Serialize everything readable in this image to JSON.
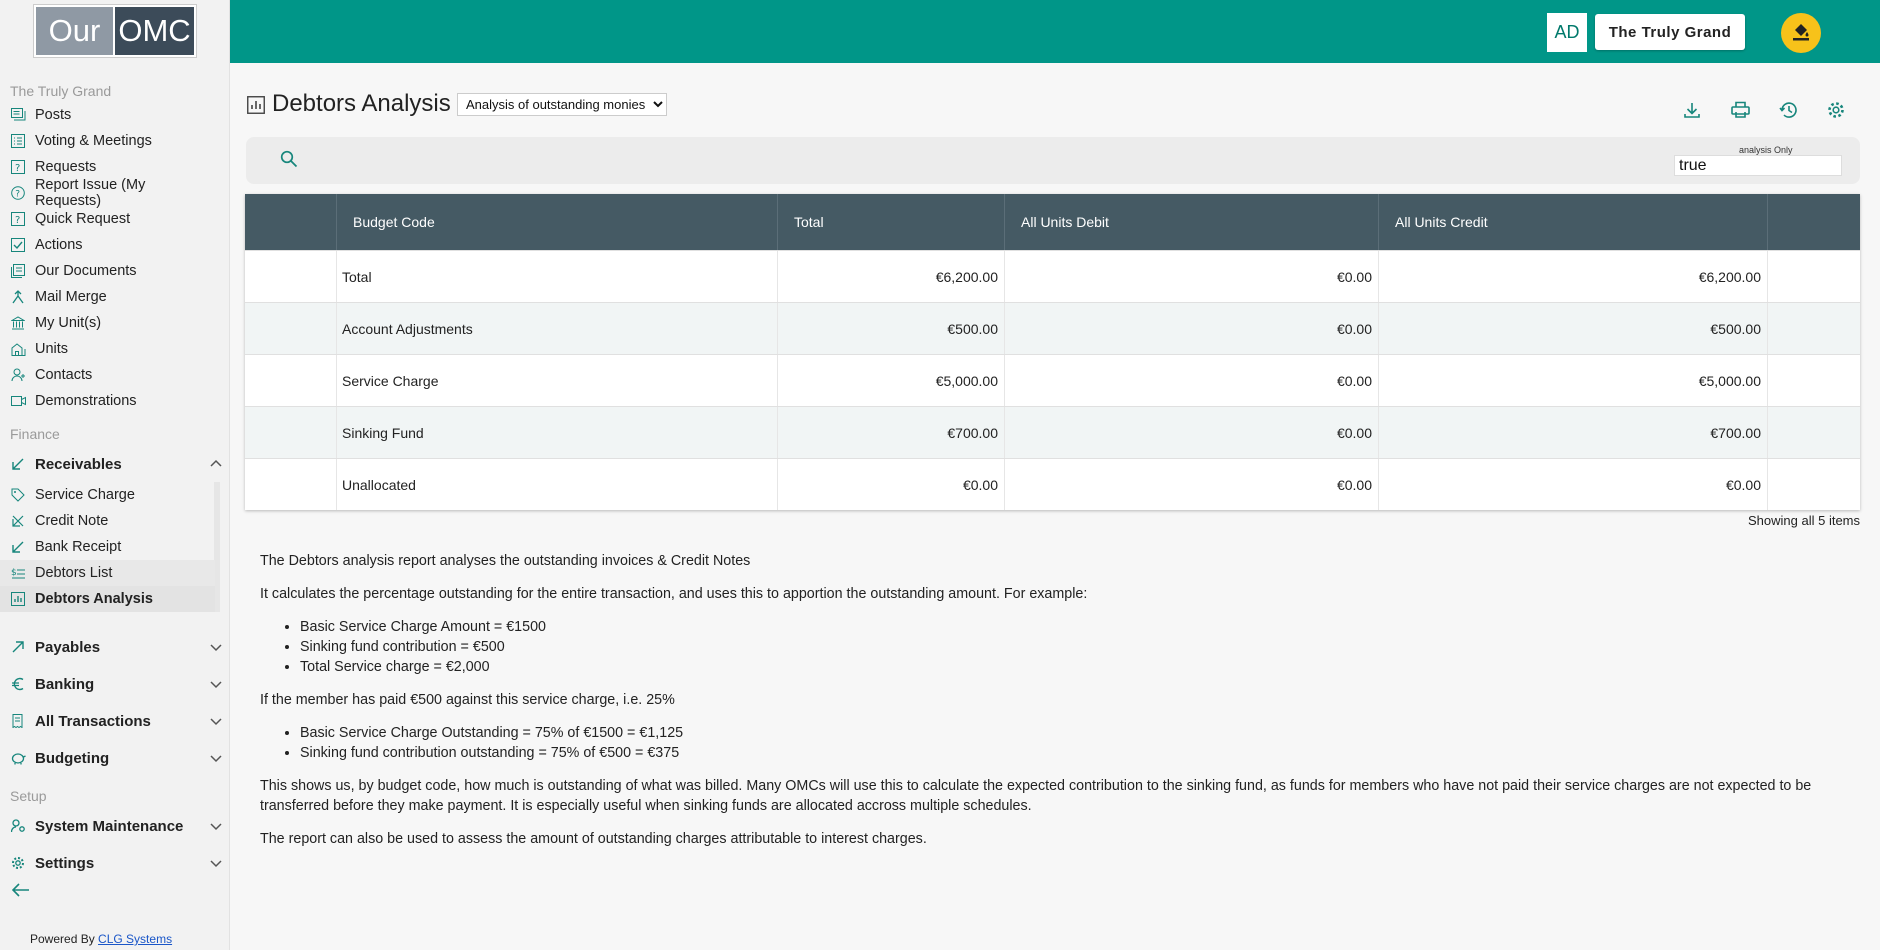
{
  "logo": {
    "part1": "Our",
    "part2": "OMC"
  },
  "sidebar": {
    "section_building": "The Truly Grand",
    "main_items": [
      {
        "label": "Posts",
        "icon": "posts-icon"
      },
      {
        "label": "Voting & Meetings",
        "icon": "voting-icon"
      },
      {
        "label": "Requests",
        "icon": "requests-icon"
      },
      {
        "label": "Report Issue (My Requests)",
        "icon": "help-icon"
      },
      {
        "label": "Quick Request",
        "icon": "quick-request-icon"
      },
      {
        "label": "Actions",
        "icon": "actions-icon"
      },
      {
        "label": "Our Documents",
        "icon": "documents-icon"
      },
      {
        "label": "Mail Merge",
        "icon": "mail-merge-icon"
      },
      {
        "label": "My Unit(s)",
        "icon": "bank-icon"
      },
      {
        "label": "Units",
        "icon": "units-icon"
      },
      {
        "label": "Contacts",
        "icon": "contacts-icon"
      },
      {
        "label": "Demonstrations",
        "icon": "demo-icon"
      }
    ],
    "section_finance": "Finance",
    "receivables": {
      "label": "Receivables",
      "expanded": true
    },
    "receivables_items": [
      {
        "label": "Service Charge",
        "icon": "tag-icon"
      },
      {
        "label": "Credit Note",
        "icon": "credit-note-icon"
      },
      {
        "label": "Bank Receipt",
        "icon": "arrow-down-left-icon"
      },
      {
        "label": "Debtors List",
        "icon": "debtors-list-icon"
      },
      {
        "label": "Debtors Analysis",
        "icon": "analysis-icon"
      }
    ],
    "groups_finance": [
      {
        "label": "Payables",
        "icon": "arrow-up-right-icon"
      },
      {
        "label": "Banking",
        "icon": "euro-icon"
      },
      {
        "label": "All Transactions",
        "icon": "transactions-icon"
      },
      {
        "label": "Budgeting",
        "icon": "piggy-bank-icon"
      }
    ],
    "section_setup": "Setup",
    "groups_setup": [
      {
        "label": "System Maintenance",
        "icon": "maintenance-icon"
      },
      {
        "label": "Settings",
        "icon": "gear-icon"
      }
    ],
    "powered_by": "Powered By",
    "powered_link": "CLG Systems"
  },
  "header": {
    "avatar_initials": "AD",
    "org_button": "The Truly Grand",
    "accent": "#009688",
    "theme_button_color": "#f7c21a"
  },
  "page": {
    "title": "Debtors Analysis",
    "report_select": "Analysis of outstanding monies",
    "toolbar_icons": [
      "download-icon",
      "print-icon",
      "history-icon",
      "settings-icon"
    ]
  },
  "filter": {
    "analysis_only_label": "analysis Only",
    "analysis_only_value": "true"
  },
  "table": {
    "columns": [
      "Budget Code",
      "Total",
      "All Units Debit",
      "All Units Credit"
    ],
    "rows": [
      {
        "code": "Total",
        "total": "€6,200.00",
        "debit": "€0.00",
        "credit": "€6,200.00"
      },
      {
        "code": "Account Adjustments",
        "total": "€500.00",
        "debit": "€0.00",
        "credit": "€500.00"
      },
      {
        "code": "Service Charge",
        "total": "€5,000.00",
        "debit": "€0.00",
        "credit": "€5,000.00"
      },
      {
        "code": "Sinking Fund",
        "total": "€700.00",
        "debit": "€0.00",
        "credit": "€700.00"
      },
      {
        "code": "Unallocated",
        "total": "€0.00",
        "debit": "€0.00",
        "credit": "€0.00"
      }
    ],
    "header_bg": "#455a64",
    "footer": "Showing all 5 items"
  },
  "description": {
    "p1": "The Debtors analysis report analyses the outstanding invoices & Credit Notes",
    "p2": "It calculates the percentage outstanding for the entire transaction, and uses this to apportion the outstanding amount. For example:",
    "list1": [
      "Basic Service Charge Amount = €1500",
      "Sinking fund contribution = €500",
      "Total Service charge = €2,000"
    ],
    "p3": "If the member has paid €500 against this service charge, i.e. 25%",
    "list2": [
      "Basic Service Charge Outstanding = 75% of €1500 = €1,125",
      "Sinking fund contribution outstanding = 75% of €500 = €375"
    ],
    "p4": "This shows us, by budget code, how much is outstanding of what was billed. Many OMCs will use this to calculate the expected contribution to the sinking fund, as funds for members who have not paid their service charges are not expected to be transferred before they make payment. It is especially useful when sinking funds are allocated accross multiple schedules.",
    "p5": "The report can also be used to assess the amount of outstanding charges attributable to interest charges."
  }
}
